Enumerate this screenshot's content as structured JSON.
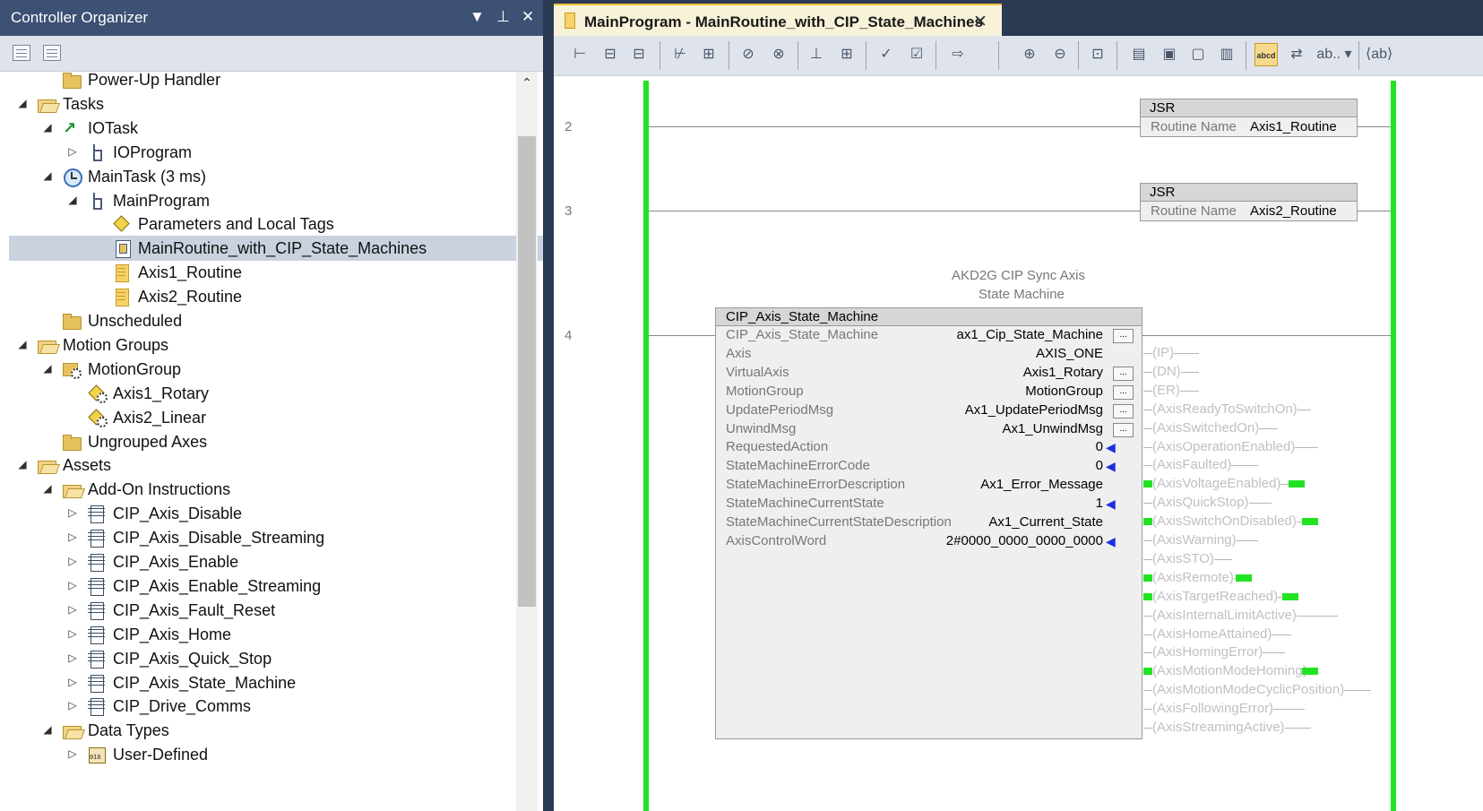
{
  "organizer": {
    "title": "Controller Organizer",
    "title_icons": [
      "▼",
      "⊥",
      "✕"
    ],
    "toolbar_icons": [
      "collapse-all-icon",
      "expand-all-icon"
    ],
    "tree": [
      {
        "label": "Power-Up Handler",
        "level": 2,
        "icon": "folder",
        "expander": ""
      },
      {
        "label": "Tasks",
        "level": 1,
        "icon": "folder-open",
        "expander": "◢"
      },
      {
        "label": "IOTask",
        "level": 2,
        "icon": "task",
        "expander": "◢"
      },
      {
        "label": "IOProgram",
        "level": 3,
        "icon": "program",
        "expander": "▷"
      },
      {
        "label": "MainTask (3 ms)",
        "level": 2,
        "icon": "clock",
        "expander": "◢"
      },
      {
        "label": "MainProgram",
        "level": 3,
        "icon": "program",
        "expander": "◢"
      },
      {
        "label": "Parameters and Local Tags",
        "level": 4,
        "icon": "tag",
        "expander": ""
      },
      {
        "label": "MainRoutine_with_CIP_State_Machines",
        "level": 4,
        "icon": "routine-main",
        "expander": "",
        "selected": true
      },
      {
        "label": "Axis1_Routine",
        "level": 4,
        "icon": "routine",
        "expander": ""
      },
      {
        "label": "Axis2_Routine",
        "level": 4,
        "icon": "routine",
        "expander": ""
      },
      {
        "label": "Unscheduled",
        "level": 2,
        "icon": "folder",
        "expander": ""
      },
      {
        "label": "Motion Groups",
        "level": 1,
        "icon": "folder-open",
        "expander": "◢"
      },
      {
        "label": "MotionGroup",
        "level": 2,
        "icon": "motion",
        "expander": "◢"
      },
      {
        "label": "Axis1_Rotary",
        "level": 3,
        "icon": "axis",
        "expander": ""
      },
      {
        "label": "Axis2_Linear",
        "level": 3,
        "icon": "axis",
        "expander": ""
      },
      {
        "label": "Ungrouped Axes",
        "level": 2,
        "icon": "folder",
        "expander": ""
      },
      {
        "label": "Assets",
        "level": 1,
        "icon": "folder-open",
        "expander": "◢"
      },
      {
        "label": "Add-On Instructions",
        "level": 2,
        "icon": "folder-open",
        "expander": "◢"
      },
      {
        "label": "CIP_Axis_Disable",
        "level": 3,
        "icon": "aoi",
        "expander": "▷"
      },
      {
        "label": "CIP_Axis_Disable_Streaming",
        "level": 3,
        "icon": "aoi",
        "expander": "▷"
      },
      {
        "label": "CIP_Axis_Enable",
        "level": 3,
        "icon": "aoi",
        "expander": "▷"
      },
      {
        "label": "CIP_Axis_Enable_Streaming",
        "level": 3,
        "icon": "aoi",
        "expander": "▷"
      },
      {
        "label": "CIP_Axis_Fault_Reset",
        "level": 3,
        "icon": "aoi",
        "expander": "▷"
      },
      {
        "label": "CIP_Axis_Home",
        "level": 3,
        "icon": "aoi",
        "expander": "▷"
      },
      {
        "label": "CIP_Axis_Quick_Stop",
        "level": 3,
        "icon": "aoi",
        "expander": "▷"
      },
      {
        "label": "CIP_Axis_State_Machine",
        "level": 3,
        "icon": "aoi",
        "expander": "▷"
      },
      {
        "label": "CIP_Drive_Comms",
        "level": 3,
        "icon": "aoi",
        "expander": "▷"
      },
      {
        "label": "Data Types",
        "level": 2,
        "icon": "folder-open",
        "expander": "◢"
      },
      {
        "label": "User-Defined",
        "level": 3,
        "icon": "udt",
        "expander": "▷"
      }
    ]
  },
  "editor": {
    "tab_label": "MainProgram - MainRoutine_with_CIP_State_Machines",
    "tab_close": "✕",
    "rungs": [
      {
        "number": "2",
        "instruction": "JSR",
        "param": "Routine Name",
        "value": "Axis1_Routine"
      },
      {
        "number": "3",
        "instruction": "JSR",
        "param": "Routine Name",
        "value": "Axis2_Routine"
      },
      {
        "number": "4"
      }
    ],
    "aoi": {
      "caption_line1": "AKD2G CIP Sync Axis",
      "caption_line2": "State Machine",
      "title": "CIP_Axis_State_Machine",
      "params": [
        {
          "name": "CIP_Axis_State_Machine",
          "value": "ax1_Cip_State_Machine",
          "button": true,
          "arrow": false
        },
        {
          "name": "Axis",
          "value": "AXIS_ONE",
          "button": false,
          "arrow": false
        },
        {
          "name": "VirtualAxis",
          "value": "Axis1_Rotary",
          "button": true,
          "arrow": false
        },
        {
          "name": "MotionGroup",
          "value": "MotionGroup",
          "button": true,
          "arrow": false
        },
        {
          "name": "UpdatePeriodMsg",
          "value": "Ax1_UpdatePeriodMsg",
          "button": true,
          "arrow": false
        },
        {
          "name": "UnwindMsg",
          "value": "Ax1_UnwindMsg",
          "button": true,
          "arrow": false
        },
        {
          "name": "RequestedAction",
          "value": "0",
          "button": false,
          "arrow": true
        },
        {
          "name": "StateMachineErrorCode",
          "value": "0",
          "button": false,
          "arrow": true
        },
        {
          "name": "StateMachineErrorDescription",
          "value": "Ax1_Error_Message",
          "button": false,
          "arrow": false
        },
        {
          "name": "StateMachineCurrentState",
          "value": "1",
          "button": false,
          "arrow": true
        },
        {
          "name": "StateMachineCurrentStateDescription",
          "value": "Ax1_Current_State",
          "button": false,
          "arrow": false
        },
        {
          "name": "AxisControlWord",
          "value": "2#0000_0000_0000_0000",
          "button": false,
          "arrow": true
        }
      ],
      "button_label": "...",
      "arrow_glyph": "◀",
      "outputs": [
        {
          "label": "(IP)",
          "energized": false
        },
        {
          "label": "(DN)",
          "energized": false
        },
        {
          "label": "(ER)",
          "energized": false
        },
        {
          "label": "(AxisReadyToSwitchOn)",
          "energized": false
        },
        {
          "label": "(AxisSwitchedOn)",
          "energized": false
        },
        {
          "label": "(AxisOperationEnabled)",
          "energized": false
        },
        {
          "label": "(AxisFaulted)",
          "energized": false
        },
        {
          "label": "(AxisVoltageEnabled)",
          "energized": true
        },
        {
          "label": "(AxisQuickStop)",
          "energized": false
        },
        {
          "label": "(AxisSwitchOnDisabled)",
          "energized": true
        },
        {
          "label": "(AxisWarning)",
          "energized": false
        },
        {
          "label": "(AxisSTO)",
          "energized": false
        },
        {
          "label": "(AxisRemote)",
          "energized": true
        },
        {
          "label": "(AxisTargetReached)",
          "energized": true
        },
        {
          "label": "(AxisInternalLimitActive)",
          "energized": false
        },
        {
          "label": "(AxisHomeAttained)",
          "energized": false
        },
        {
          "label": "(AxisHomingError)",
          "energized": false
        },
        {
          "label": "(AxisMotionModeHoming)",
          "energized": true
        },
        {
          "label": "(AxisMotionModeCyclicPosition)",
          "energized": false
        },
        {
          "label": "(AxisFollowingError)",
          "energized": false
        },
        {
          "label": "(AxisStreamingActive)",
          "energized": false
        }
      ]
    }
  },
  "colors": {
    "title_bar": "#3c5174",
    "frame": "#2b3a53",
    "selection": "#c9d2de",
    "power_rail": "#22e322",
    "input_arrow": "#1d2fe0",
    "tab_accent": "#f2c53d"
  }
}
